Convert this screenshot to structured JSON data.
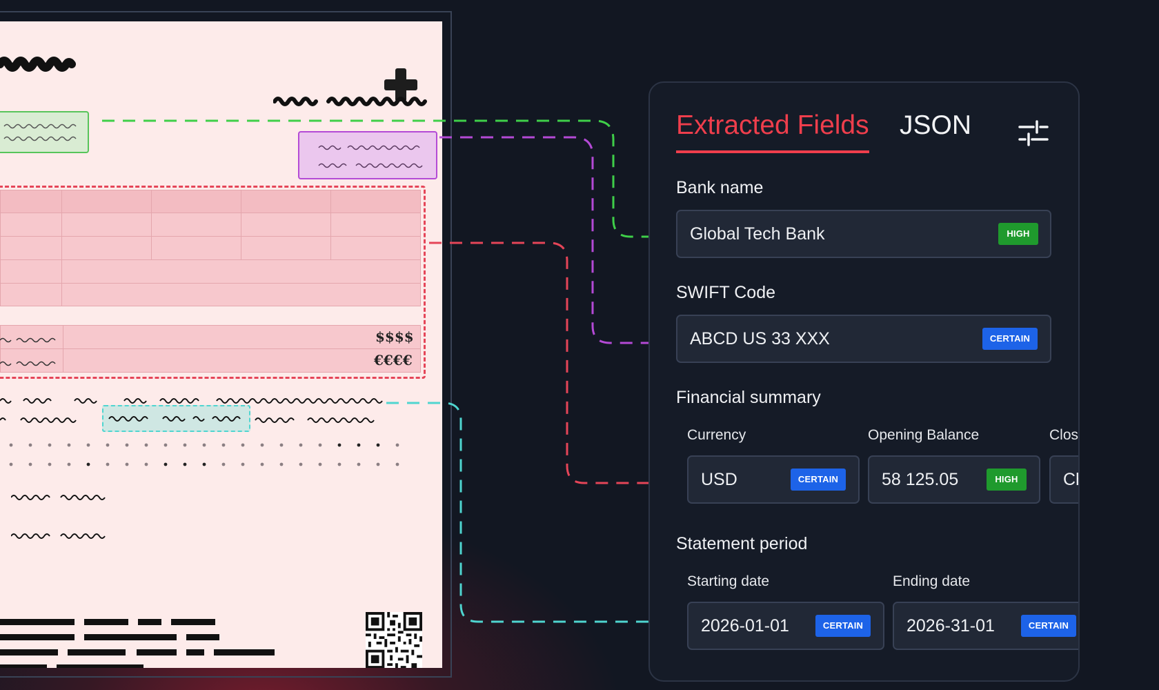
{
  "document": {
    "currency_symbols": [
      "$$$$",
      "€€€€"
    ]
  },
  "panel": {
    "tabs": [
      {
        "label": "Extracted Fields",
        "active": true
      },
      {
        "label": "JSON",
        "active": false
      }
    ],
    "settings_icon": "sliders-icon",
    "bank_name": {
      "label": "Bank name",
      "value": "Global Tech Bank",
      "confidence": "HIGH"
    },
    "swift_code": {
      "label": "SWIFT Code",
      "value": "ABCD US 33 XXX",
      "confidence": "CERTAIN"
    },
    "financial_summary": {
      "label": "Financial summary",
      "currency": {
        "label": "Currency",
        "value": "USD",
        "confidence": "CERTAIN"
      },
      "opening_balance": {
        "label": "Opening Balance",
        "value": "58 125.05",
        "confidence": "HIGH"
      },
      "closing_balance": {
        "label": "Clos",
        "value": "Ch"
      }
    },
    "statement_period": {
      "label": "Statement period",
      "starting_date": {
        "label": "Starting date",
        "value": "2026-01-01",
        "confidence": "CERTAIN"
      },
      "ending_date": {
        "label": "Ending date",
        "value": "2026-31-01",
        "confidence": "CERTAIN"
      }
    }
  },
  "colors": {
    "accent_red": "#ef3e4c",
    "high_badge": "#1f9a2d",
    "certain_badge": "#1d63e8",
    "connector_green": "#3fcf49",
    "connector_purple": "#b44ad6",
    "connector_red": "#e54558",
    "connector_teal": "#4fd5d0"
  }
}
